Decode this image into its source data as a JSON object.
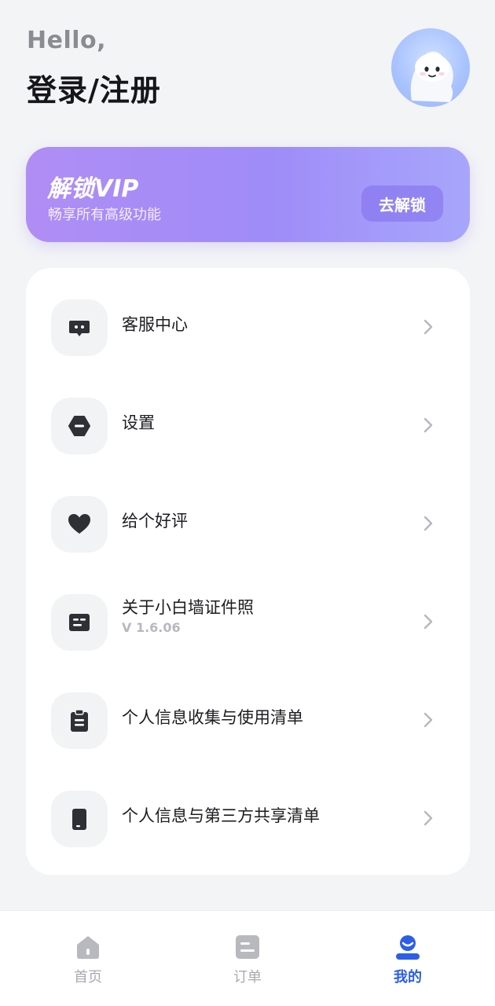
{
  "header": {
    "greeting": "Hello,",
    "login_title": "登录/注册",
    "avatar_icon": "mascot-avatar-icon"
  },
  "vip_banner": {
    "title": "解锁VIP",
    "subtitle": "畅享所有高级功能",
    "button_label": "去解锁",
    "gradient_start": "#b08df5",
    "gradient_end": "#a7a6fb"
  },
  "menu": {
    "items": [
      {
        "label": "客服中心",
        "icon": "customer-service-icon"
      },
      {
        "label": "设置",
        "icon": "settings-icon"
      },
      {
        "label": "给个好评",
        "icon": "heart-icon"
      },
      {
        "label": "关于小白墙证件照",
        "sub": "V 1.6.06",
        "icon": "about-card-icon"
      },
      {
        "label": "个人信息收集与使用清单",
        "icon": "clipboard-icon"
      },
      {
        "label": "个人信息与第三方共享清单",
        "icon": "phone-icon"
      }
    ]
  },
  "tabbar": {
    "tabs": [
      {
        "label": "首页",
        "icon": "home-icon",
        "active": false
      },
      {
        "label": "订单",
        "icon": "order-icon",
        "active": false
      },
      {
        "label": "我的",
        "icon": "profile-icon",
        "active": true
      }
    ],
    "active_color": "#2c5ee8",
    "inactive_color": "#a8aab0"
  }
}
